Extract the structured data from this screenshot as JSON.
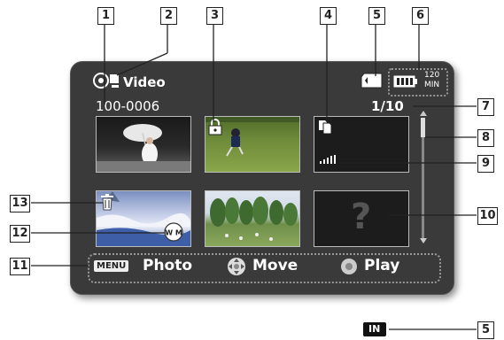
{
  "screen": {
    "mode_label": "Video",
    "folder_file_number": "100-0006",
    "page_counter": "1/10",
    "battery_time_top": "120",
    "battery_time_unit": "MIN"
  },
  "bottom_bar": {
    "menu_key": "MENU",
    "photo_label": "Photo",
    "move_label": "Move",
    "play_label": "Play"
  },
  "thumbnails": {
    "error_mark": "?"
  },
  "callouts": [
    "1",
    "2",
    "3",
    "4",
    "5",
    "6",
    "7",
    "8",
    "9",
    "10",
    "11",
    "12",
    "13"
  ],
  "footer": {
    "internal_memory_label": "IN",
    "callout": "5"
  },
  "icons": {
    "mode": "video-camera-icon",
    "lock": "lock-icon",
    "copy": "copy-icon",
    "storage": "memory-card-icon",
    "battery": "battery-icon",
    "delete": "trash-icon",
    "wide_mode": "wm-icon",
    "move": "dpad-icon",
    "play": "ok-button-icon",
    "internal_memory": "internal-memory-icon"
  }
}
